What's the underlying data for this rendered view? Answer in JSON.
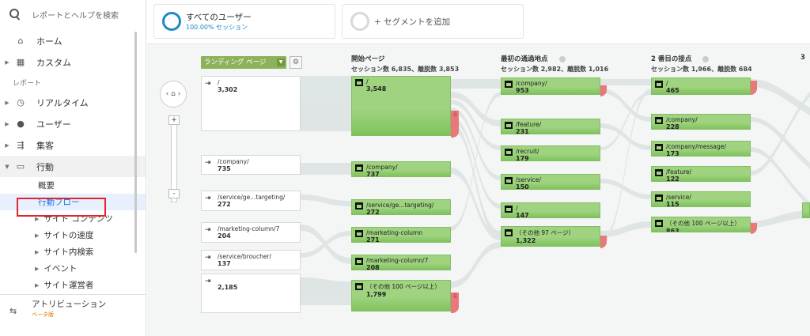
{
  "sidebar": {
    "search_placeholder": "レポートとヘルプを検索",
    "home": "ホーム",
    "custom": "カスタム",
    "section_reports": "レポート",
    "realtime": "リアルタイム",
    "audience": "ユーザー",
    "acquisition": "集客",
    "behavior": "行動",
    "behavior_items": {
      "overview": "概要",
      "flow": "行動フロー",
      "site_content": "サイト コンテンツ",
      "site_speed": "サイトの速度",
      "site_search": "サイト内検索",
      "events": "イベント",
      "publisher": "サイト運営者"
    },
    "attribution": "アトリビューション",
    "attribution_beta": "ベータ版"
  },
  "segments": {
    "all_users": "すべてのユーザー",
    "all_users_pct": "100.00% セッション",
    "add_segment": "+ セグメントを追加"
  },
  "flow": {
    "landing_select": "ランディング ページ",
    "columns": [
      {
        "title": "開始ページ",
        "sub": "セッション数 6,835、離脱数 3,853"
      },
      {
        "title": "最初の通過地点",
        "sub": "セッション数 2,982、離脱数 1,016"
      },
      {
        "title": "2 番目の接点",
        "sub": "セッション数 1,966、離脱数 684"
      },
      {
        "title": "3"
      }
    ],
    "landing": [
      {
        "name": "/",
        "value": "3,302"
      },
      {
        "name": "/company/",
        "value": "735"
      },
      {
        "name": "/service/ge...targeting/",
        "value": "272"
      },
      {
        "name": "/marketing-column/7",
        "value": "204"
      },
      {
        "name": "/service/broucher/",
        "value": "137"
      },
      {
        "name": "",
        "value": "2,185"
      }
    ],
    "start": [
      {
        "name": "/",
        "value": "3,548"
      },
      {
        "name": "/company/",
        "value": "737"
      },
      {
        "name": "/service/ge...targeting/",
        "value": "272"
      },
      {
        "name": "/marketing-column",
        "value": "271"
      },
      {
        "name": "/marketing-column/7",
        "value": "208"
      },
      {
        "name": "（その他 100 ページ以上）",
        "value": "1,799"
      }
    ],
    "first": [
      {
        "name": "/company/",
        "value": "953"
      },
      {
        "name": "/feature/",
        "value": "231"
      },
      {
        "name": "/recruit/",
        "value": "179"
      },
      {
        "name": "/service/",
        "value": "150"
      },
      {
        "name": "/",
        "value": "147"
      },
      {
        "name": "（その他 97 ページ）",
        "value": "1,322"
      }
    ],
    "second": [
      {
        "name": "/",
        "value": "465"
      },
      {
        "name": "/company/",
        "value": "228"
      },
      {
        "name": "/company/message/",
        "value": "173"
      },
      {
        "name": "/feature/",
        "value": "122"
      },
      {
        "name": "/service/",
        "value": "115"
      },
      {
        "name": "（その他 100 ページ以上）",
        "value": "863"
      }
    ]
  },
  "colors": {
    "accent": "#1e88c9",
    "node_green": "#9fd37f",
    "dropoff": "#e9787a",
    "highlight": "#e0262b"
  }
}
